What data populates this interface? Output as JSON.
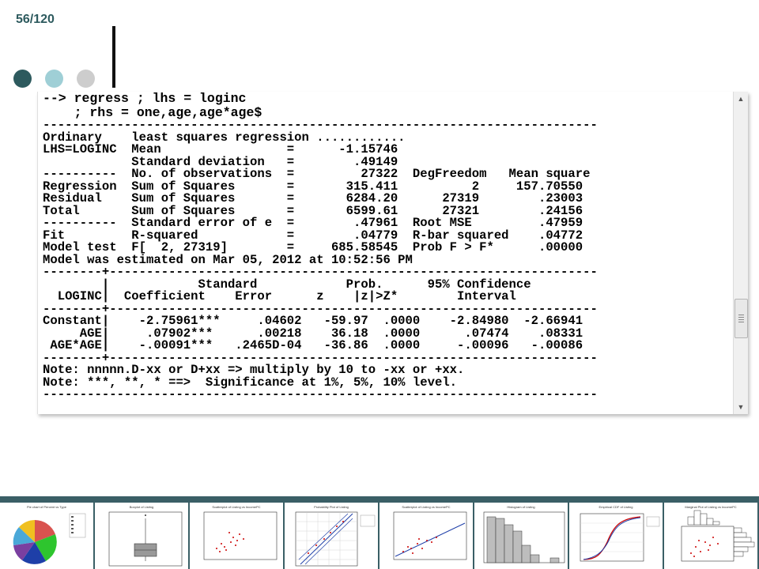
{
  "slide": {
    "number_label": "56/120"
  },
  "console": {
    "command_lines": [
      "--> regress ; lhs = loginc",
      "    ; rhs = one,age,age*age$"
    ],
    "output_lines": [
      "---------------------------------------------------------------------------",
      "Ordinary    least squares regression ............",
      "LHS=LOGINC  Mean                 =      -1.15746",
      "            Standard deviation   =        .49149",
      "----------  No. of observations  =         27322  DegFreedom   Mean square",
      "Regression  Sum of Squares       =       315.411          2     157.70550",
      "Residual    Sum of Squares       =       6284.20      27319        .23003",
      "Total       Sum of Squares       =       6599.61      27321        .24156",
      "----------  Standard error of e  =        .47961  Root MSE         .47959",
      "Fit         R-squared            =        .04779  R-bar squared    .04772",
      "Model test  F[  2, 27319]        =     685.58545  Prob F > F*      .00000",
      "Model was estimated on Mar 05, 2012 at 10:52:56 PM",
      "--------+------------------------------------------------------------------",
      "        |            Standard            Prob.      95% Confidence",
      "  LOGINC|  Coefficient    Error      z    |z|>Z*        Interval",
      "--------+------------------------------------------------------------------",
      "Constant|    -2.75961***     .04602   -59.97  .0000    -2.84980  -2.66941",
      "     AGE|     .07902***      .00218    36.18  .0000      .07474    .08331",
      " AGE*AGE|    -.00091***   .2465D-04   -36.86  .0000     -.00096   -.00086",
      "--------+------------------------------------------------------------------",
      "Note: nnnnn.D-xx or D+xx => multiply by 10 to -xx or +xx.",
      "Note: ***, **, * ==>  Significance at 1%, 5%, 10% level.",
      "---------------------------------------------------------------------------"
    ]
  },
  "thumbnails": [
    {
      "title": "Pie chart of Percent vs Type",
      "icon": "pie-chart"
    },
    {
      "title": "Boxplot of Listing",
      "icon": "boxplot"
    },
    {
      "title": "Scatterplot of Listing vs IncomePC",
      "icon": "scatter"
    },
    {
      "title": "Probability Plot of Listing",
      "icon": "probability-plot"
    },
    {
      "title": "Scatterplot of Listing vs IncomePC",
      "icon": "scatter-fit"
    },
    {
      "title": "Histogram of Listing",
      "icon": "histogram"
    },
    {
      "title": "Empirical CDF of Listing",
      "icon": "ecdf"
    },
    {
      "title": "Marginal Plot of Listing vs IncomePC",
      "icon": "marginal-plot"
    }
  ],
  "colors": {
    "accent_dark": "#2d5a5e",
    "accent_light": "#9fcfd6",
    "accent_gray": "#cdcdcd",
    "strip": "#3a5f66"
  }
}
